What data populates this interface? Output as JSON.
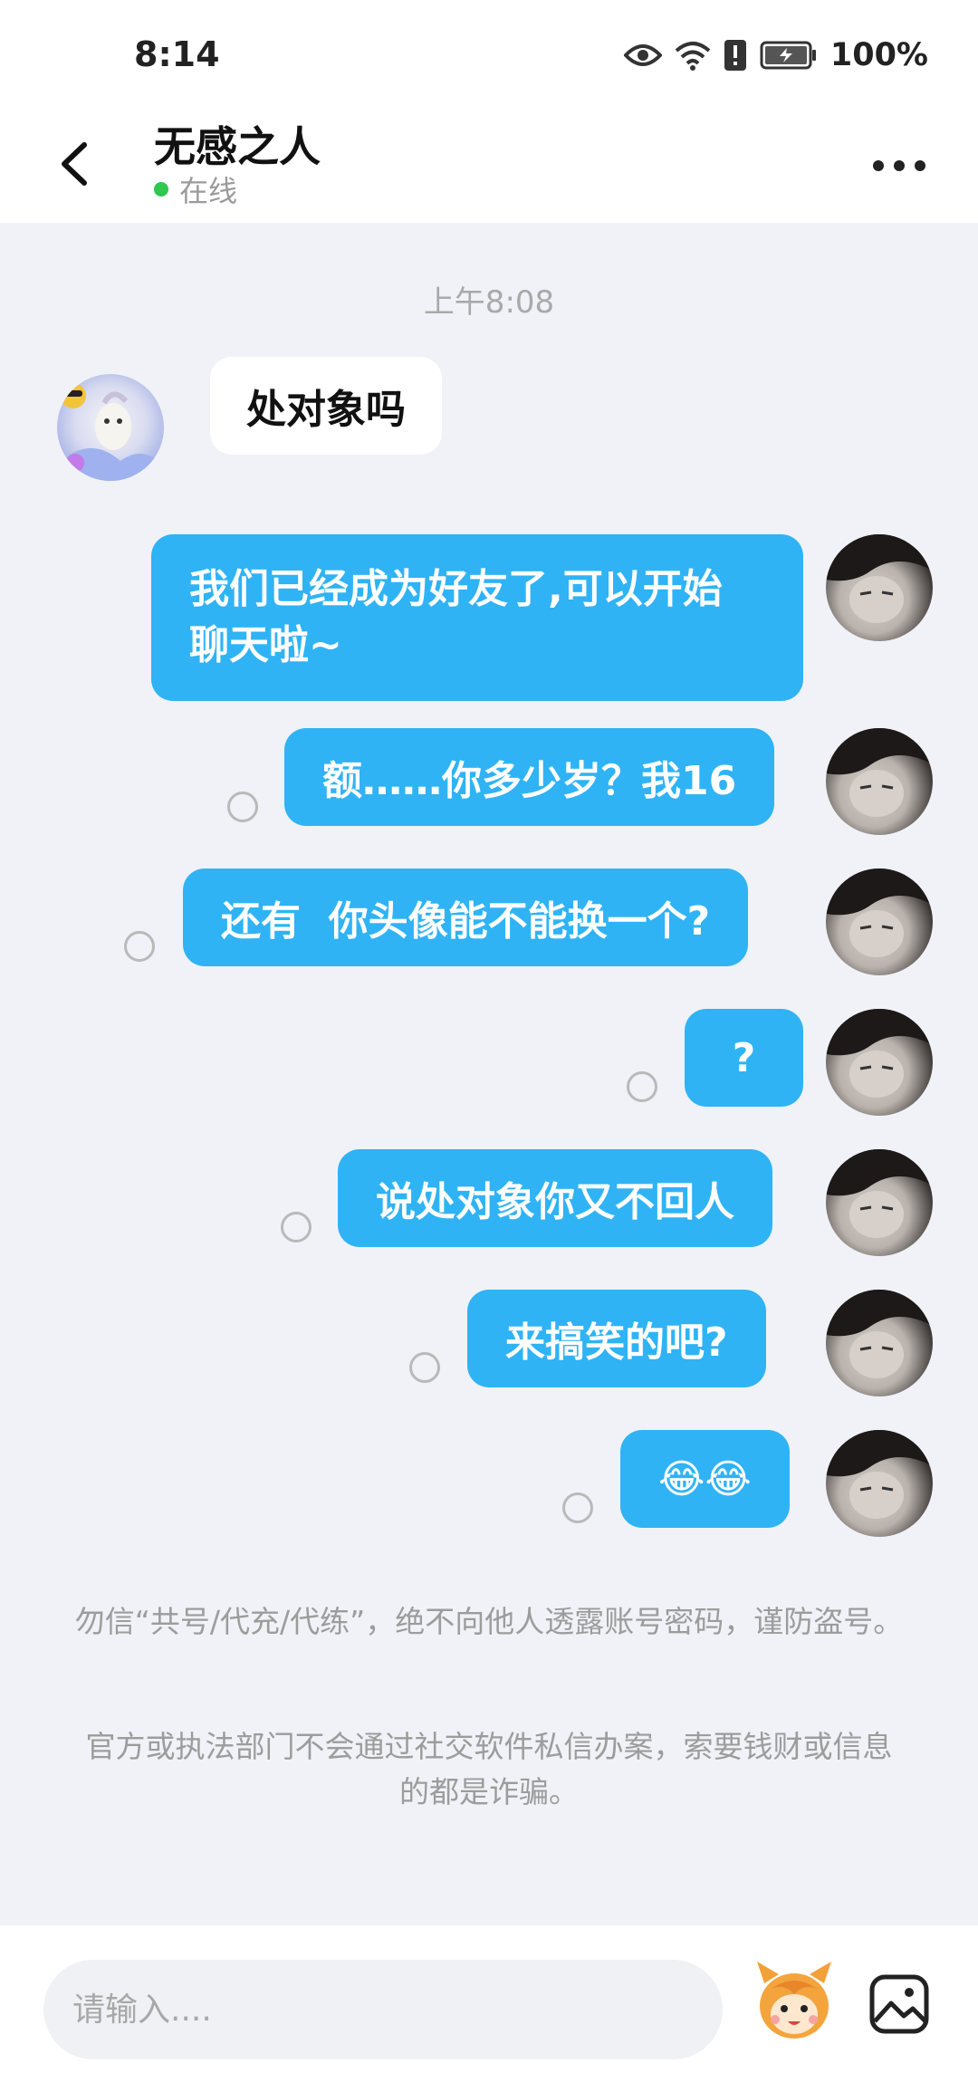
{
  "status_bar": {
    "time": "8:14",
    "battery": "100%"
  },
  "header": {
    "contact_name": "无感之人",
    "status": "在线"
  },
  "chat": {
    "timestamp": "上午8:08",
    "messages": [
      {
        "sender": "friend",
        "text": "处对象吗"
      },
      {
        "sender": "me",
        "lines": [
          "我们已经成为好友了,可以开始",
          "聊天啦~"
        ]
      },
      {
        "sender": "me",
        "text": "额……你多少岁？我16"
      },
      {
        "sender": "me",
        "text": "还有  你头像能不能换一个?"
      },
      {
        "sender": "me",
        "text": "?"
      },
      {
        "sender": "me",
        "text": "说处对象你又不回人"
      },
      {
        "sender": "me",
        "text": "来搞笑的吧?"
      },
      {
        "sender": "me",
        "text": "😂😂"
      }
    ],
    "notices": [
      "勿信“共号/代充/代练”，绝不向他人透露账号密码，谨防盗号。",
      "官方或执法部门不会通过社交软件私信办案，索要钱财或信息的都是诈骗。"
    ]
  },
  "input": {
    "placeholder": "请输入...."
  },
  "icons": {
    "back": "chevron-left-icon",
    "more": "more-dots-icon",
    "mascot": "mascot-emoji-icon",
    "image": "image-icon"
  },
  "colors": {
    "bubble_out": "#2fb3f5",
    "online": "#2dc84d",
    "background": "#f0f2f7"
  }
}
